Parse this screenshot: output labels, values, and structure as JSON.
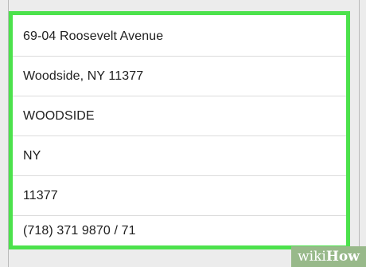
{
  "address_fields": [
    {
      "value": "69-04 Roosevelt Avenue"
    },
    {
      "value": "Woodside, NY 11377"
    },
    {
      "value": "WOODSIDE"
    },
    {
      "value": "NY"
    },
    {
      "value": "11377"
    },
    {
      "value": "(718) 371 9870 / 71"
    }
  ],
  "highlight_color": "#4ce24c",
  "watermark": {
    "part1": "wiki",
    "part2": "How"
  }
}
